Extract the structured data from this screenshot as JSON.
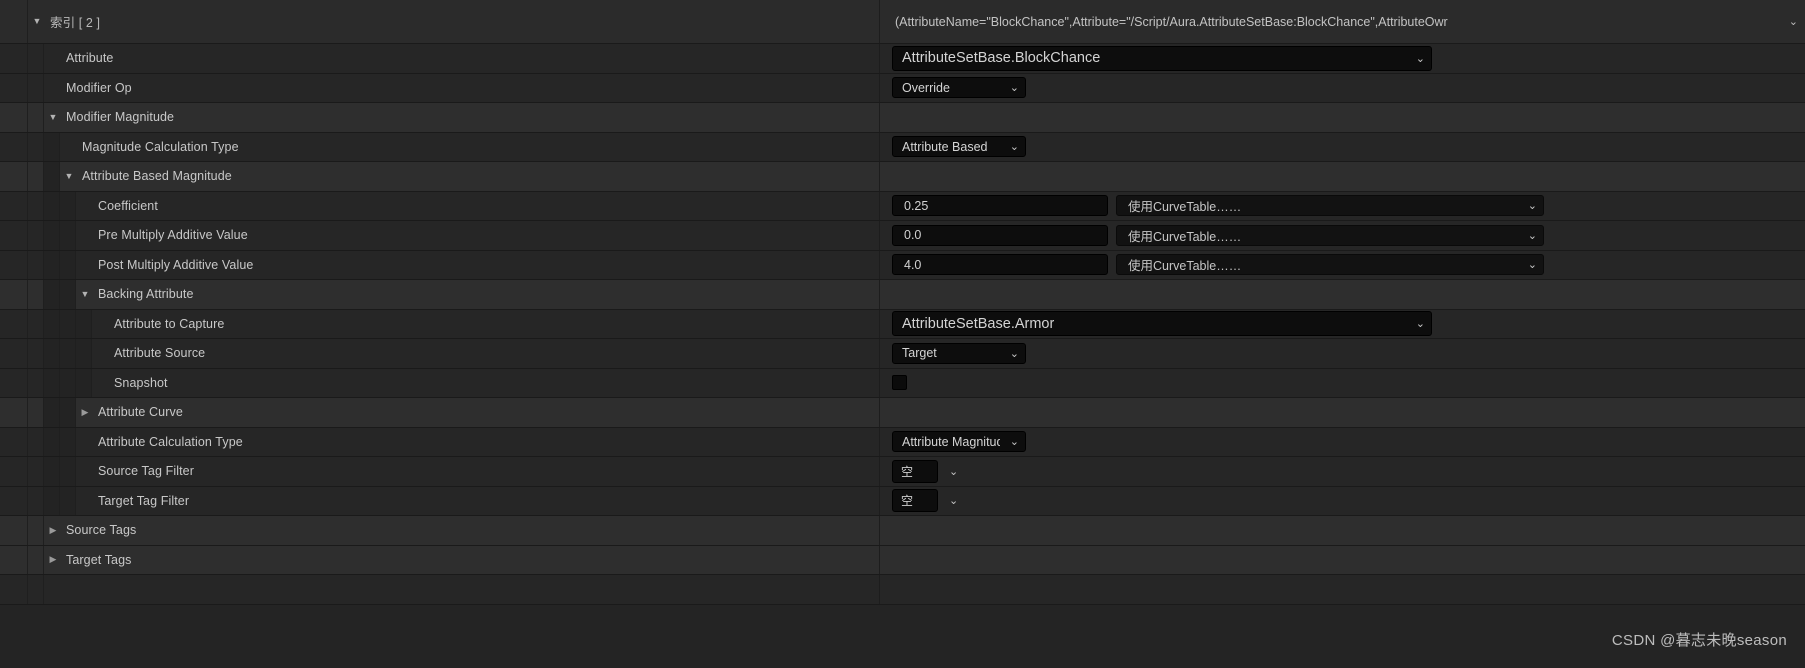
{
  "panel": {
    "index_row": {
      "label": "索引 [ 2 ]",
      "twisty": "expanded",
      "value": "(AttributeName=\"BlockChance\",Attribute=\"/Script/Aura.AttributeSetBase:BlockChance\",AttributeOwr",
      "chevron": "chevron-down-icon"
    },
    "rows": [
      {
        "label": "Attribute",
        "widget": "combo-big",
        "value": "AttributeSetBase.BlockChance"
      },
      {
        "label": "Modifier Op",
        "widget": "combo-enum",
        "value": "Override"
      },
      {
        "label": "Modifier Magnitude",
        "widget": "none",
        "value": ""
      },
      {
        "label": "Magnitude Calculation Type",
        "widget": "combo-enum",
        "value": "Attribute Based"
      },
      {
        "label": "Attribute Based Magnitude",
        "widget": "none",
        "value": ""
      },
      {
        "label": "Coefficient",
        "widget": "num-curve",
        "value": "0.25",
        "curve": "使用CurveTable……"
      },
      {
        "label": "Pre Multiply Additive Value",
        "widget": "num-curve",
        "value": "0.0",
        "curve": "使用CurveTable……"
      },
      {
        "label": "Post Multiply Additive Value",
        "widget": "num-curve",
        "value": "4.0",
        "curve": "使用CurveTable……"
      },
      {
        "label": "Backing Attribute",
        "widget": "none",
        "value": ""
      },
      {
        "label": "Attribute to Capture",
        "widget": "combo-big",
        "value": "AttributeSetBase.Armor"
      },
      {
        "label": "Attribute Source",
        "widget": "combo-enum",
        "value": "Target"
      },
      {
        "label": "Snapshot",
        "widget": "checkbox",
        "value": ""
      },
      {
        "label": "Attribute Curve",
        "widget": "none",
        "value": ""
      },
      {
        "label": "Attribute Calculation Type",
        "widget": "combo-enum",
        "value": "Attribute Magnitude"
      },
      {
        "label": "Source Tag Filter",
        "widget": "tagfilter",
        "value": "空"
      },
      {
        "label": "Target Tag Filter",
        "widget": "tagfilter",
        "value": "空"
      },
      {
        "label": "Source Tags",
        "widget": "none",
        "value": ""
      },
      {
        "label": "Target Tags",
        "widget": "none",
        "value": ""
      }
    ],
    "watermark": "CSDN @暮志未晚season"
  },
  "icons": {
    "expanded": "▼",
    "collapsed": "▶",
    "chevron_down": "⌄"
  }
}
